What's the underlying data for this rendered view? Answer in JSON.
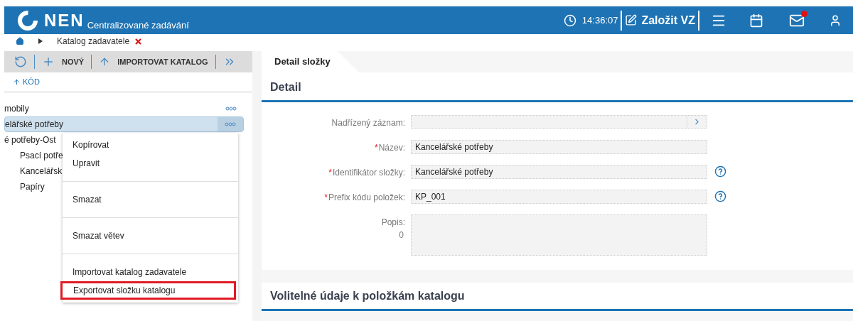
{
  "header": {
    "logo": "NEN",
    "subtitle": "Centralizované zadávání",
    "time": "14:36:07",
    "create_button": "Založit VZ",
    "mail_unread": true
  },
  "breadcrumb": {
    "current": "Katalog zadavatele"
  },
  "toolbar": {
    "buttons": [
      {
        "kind": "refresh"
      },
      {
        "kind": "add",
        "label": "NOVÝ"
      },
      {
        "kind": "import",
        "label": "IMPORTOVAT KATALOG"
      },
      {
        "kind": "more"
      }
    ]
  },
  "sort": {
    "label": "KÓD"
  },
  "tree": [
    {
      "label": "mobily",
      "selected": false,
      "menu": true
    },
    {
      "label": "elářské potřeby",
      "selected": true,
      "menu": true
    },
    {
      "label": "é potřeby-Ost",
      "selected": false,
      "children": [
        {
          "label": "Psací potře",
          "selected": false
        },
        {
          "label": "Kancelářsk",
          "selected": false
        },
        {
          "label": "Papíry",
          "selected": false
        }
      ]
    }
  ],
  "context_menu": [
    {
      "label": "Kopírovat",
      "divider_after": false,
      "highlighted": false
    },
    {
      "label": "Upravit",
      "divider_after": true,
      "highlighted": false
    },
    {
      "label": "Smazat",
      "divider_after": true,
      "highlighted": false
    },
    {
      "label": "Smazat větev",
      "divider_after": true,
      "highlighted": false
    },
    {
      "label": "Importovat katalog zadavatele",
      "divider_after": false,
      "highlighted": false
    },
    {
      "label": "Exportovat složku katalogu",
      "divider_after": false,
      "highlighted": true
    }
  ],
  "tab": {
    "label": "Detail složky"
  },
  "detail": {
    "title": "Detail",
    "fields": [
      {
        "kind": "lookup",
        "label": "Nadřízený záznam:",
        "help": false
      },
      {
        "kind": "text",
        "required_mark": "*",
        "label": "Název:",
        "value": "Kancelářské potřeby",
        "help": false
      },
      {
        "kind": "text",
        "required_mark": "*",
        "label": "Identifikátor složky:",
        "value": "Kancelářské potřeby",
        "help": true
      },
      {
        "kind": "text",
        "required_mark": "*",
        "label": "Prefix kódu položek:",
        "value": "KP_001",
        "help": true
      },
      {
        "kind": "textarea",
        "label": "Popis:",
        "counter": "0",
        "help": false
      }
    ]
  },
  "section2": {
    "title": "Volitelné údaje k položkám katalogu"
  }
}
